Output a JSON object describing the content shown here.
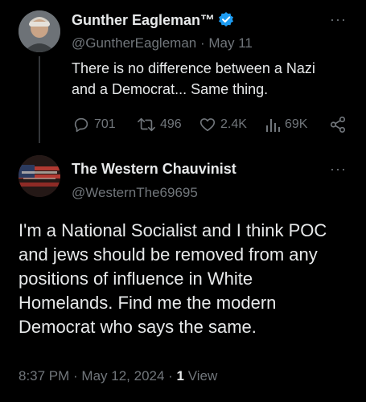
{
  "parent_post": {
    "display_name": "Gunther Eagleman™",
    "handle": "@GuntherEagleman",
    "separator": "·",
    "date": "May 11",
    "text_line1": "There is no difference between a Nazi",
    "text_line2": "and a Democrat...  Same thing.",
    "replies": "701",
    "reposts": "496",
    "likes": "2.4K",
    "views": "69K",
    "more": "···",
    "verified": true
  },
  "reply_post": {
    "display_name": "The Western Chauvinist",
    "handle": "@WesternThe69695",
    "more": "···",
    "text_lines": [
      "I'm a National Socialist and I think POC",
      "and jews should be removed from any",
      "positions of influence in White",
      "Homelands.  Find me the modern",
      "Democrat who says the same."
    ],
    "timestamp": "8:37 PM · May 12, 2024 · ",
    "view_count": "1",
    "view_label": "View"
  },
  "colors": {
    "background": "#000000",
    "text": "#e7e9ea",
    "muted": "#71767b",
    "verified_badge": "#1d9bf0"
  }
}
